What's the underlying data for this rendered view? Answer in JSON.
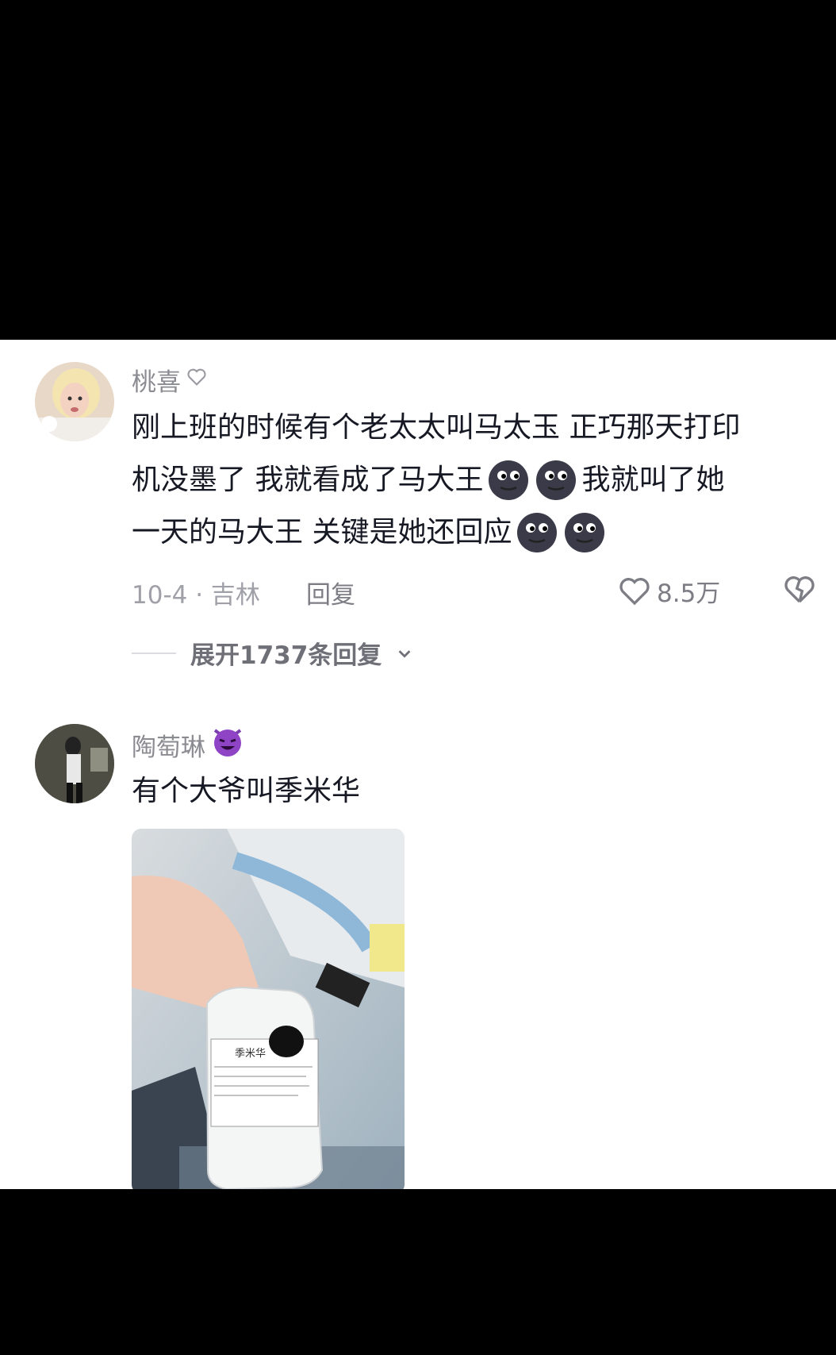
{
  "comments": [
    {
      "username": "桃喜",
      "badge": "heart-outline",
      "lines": [
        [
          "刚上班的时候有个老太太叫马太玉 正巧那天打印"
        ],
        [
          "机没墨了 我就看成了马大王",
          "EMOJI",
          " 我就叫了她"
        ],
        [
          "一天的马大王 关键是她还回应",
          "EMOJI"
        ]
      ],
      "date_location": "10-4 · 吉林",
      "reply_label": "回复",
      "like_count": "8.5万",
      "expand_label": "展开1737条回复"
    },
    {
      "username": "陶萄琳",
      "badge": "smiling-devil",
      "text": "有个大爷叫季米华",
      "image_label": "季米华"
    }
  ],
  "colors": {
    "username": "#8b8b92",
    "text": "#161823",
    "meta": "#a0a0a8"
  }
}
